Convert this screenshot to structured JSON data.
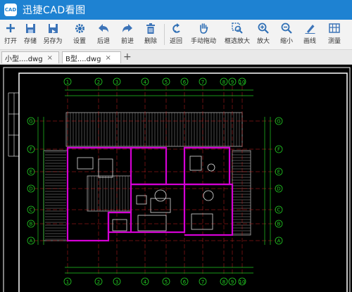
{
  "window": {
    "logo_text": "CAD",
    "title": "迅捷CAD看图"
  },
  "toolbar": {
    "items": [
      {
        "label": "打开",
        "icon": "plus-icon"
      },
      {
        "label": "存储",
        "icon": "save-icon"
      },
      {
        "label": "另存为",
        "icon": "save-as-icon"
      },
      {
        "label": "设置",
        "icon": "gear-icon"
      },
      {
        "label": "后退",
        "icon": "undo-arrow-icon"
      },
      {
        "label": "前进",
        "icon": "redo-arrow-icon"
      },
      {
        "label": "删除",
        "icon": "trash-icon"
      },
      {
        "label": "返回",
        "icon": "return-icon"
      },
      {
        "label": "手动拖动",
        "icon": "hand-icon"
      },
      {
        "label": "框选放大",
        "icon": "box-zoom-icon"
      },
      {
        "label": "放大",
        "icon": "zoom-in-icon"
      },
      {
        "label": "缩小",
        "icon": "zoom-out-icon"
      },
      {
        "label": "画线",
        "icon": "pencil-icon"
      },
      {
        "label": "测量",
        "icon": "measure-icon"
      }
    ]
  },
  "tabs": [
    {
      "label": "小型....dwg",
      "close": "×",
      "active": false
    },
    {
      "label": "B型....dwg",
      "close": "×",
      "active": true
    }
  ],
  "tab_add": "+",
  "drawing": {
    "top_axis": [
      "1",
      "2",
      "3",
      "4",
      "5",
      "6",
      "7",
      "8",
      "9",
      "10"
    ],
    "side_axis": [
      "G",
      "F",
      "E",
      "D",
      "C",
      "B",
      "A"
    ],
    "colors": {
      "background": "#000000",
      "frame": "#ffffff",
      "walls": "#d400d4",
      "dimensions": "#22cc22",
      "axis_lines": "#cc2222",
      "detail": "#dddddd",
      "text": "#ffff00"
    }
  }
}
